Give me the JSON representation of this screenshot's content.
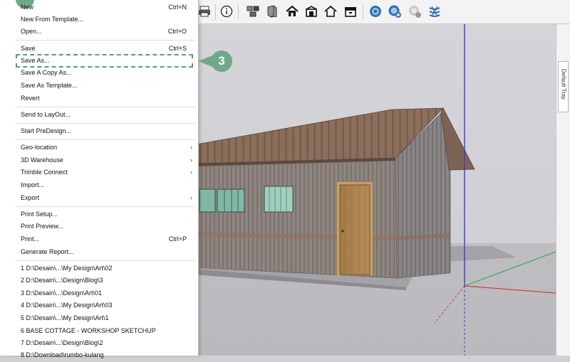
{
  "menu": {
    "items": [
      {
        "label": "New",
        "shortcut": "Ctrl+N"
      },
      {
        "label": "New From Template..."
      },
      {
        "label": "Open...",
        "shortcut": "Ctrl+O"
      },
      {
        "label": "Save",
        "shortcut": "Ctrl+S"
      },
      {
        "label": "Save As..."
      },
      {
        "label": "Save A Copy As..."
      },
      {
        "label": "Save As Template..."
      },
      {
        "label": "Revert"
      },
      {
        "label": "Send to LayOut..."
      },
      {
        "label": "Start PreDesign..."
      },
      {
        "label": "Geo-location",
        "arrow": "›"
      },
      {
        "label": "3D Warehouse",
        "arrow": "›"
      },
      {
        "label": "Trimble Connect",
        "arrow": "›"
      },
      {
        "label": "Import..."
      },
      {
        "label": "Export",
        "arrow": "›"
      },
      {
        "label": "Print Setup..."
      },
      {
        "label": "Print Preview..."
      },
      {
        "label": "Print...",
        "shortcut": "Ctrl+P"
      },
      {
        "label": "Generate Report..."
      }
    ],
    "recent": [
      "1 D:\\Desain\\...\\My Design\\Art\\02",
      "2 D:\\Desain\\...\\Design\\Blog\\3",
      "3 D:\\Desain\\...\\Design\\Art\\01",
      "4 D:\\Desain\\...\\My Design\\Art\\03",
      "5 D:\\Desain\\...\\My Design\\Art\\1",
      "6 BASE COTTAGE - WORKSHOP SKETCHUP",
      "7 D:\\Desain\\...\\Design\\Blog\\2",
      "8 D:\\Download\\rumbo-kulang"
    ]
  },
  "callout": {
    "number": "3",
    "color": "#6fa888"
  },
  "tray": {
    "label": "Default Tray"
  },
  "toolbar": {
    "icons": [
      "print-icon",
      "model-info-icon",
      "components-icon",
      "materials-icon",
      "house-icon",
      "warehouse-icon",
      "home-outline-icon",
      "extension-warehouse-icon",
      "geo-location-icon",
      "add-location-icon",
      "photo-textures-icon",
      "sandbox-icon"
    ]
  },
  "colors": {
    "accent": "#6fa888",
    "axis_blue": "#3b3bd6",
    "axis_green": "#2fae4a",
    "axis_red": "#d23a3a"
  }
}
